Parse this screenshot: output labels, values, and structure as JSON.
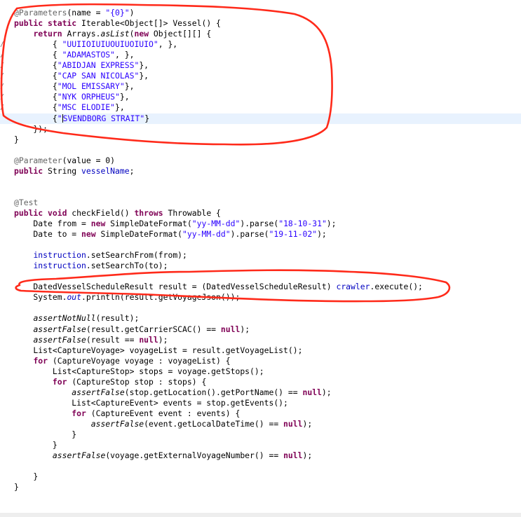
{
  "editor": {
    "lines": [
      [
        [
          "ann",
          "@Parameters"
        ],
        [
          "",
          "(name = "
        ],
        [
          "str",
          "\"{0}\""
        ],
        [
          "",
          ")"
        ]
      ],
      [
        [
          "kw",
          "public static "
        ],
        [
          "",
          "Iterable<Object[]> Vessel() {"
        ]
      ],
      [
        [
          "",
          "    "
        ],
        [
          "kw",
          "return "
        ],
        [
          "",
          "Arrays."
        ],
        [
          "smeth",
          "asList"
        ],
        [
          "",
          "("
        ],
        [
          "kw",
          "new "
        ],
        [
          "",
          "Object[][] {"
        ]
      ],
      [
        [
          "",
          "        { "
        ],
        [
          "str",
          "\"UUIIOIUIUOUIUOIUIO\""
        ],
        [
          "",
          ", },"
        ]
      ],
      [
        [
          "",
          "        { "
        ],
        [
          "str",
          "\"ADAMASTOS\""
        ],
        [
          "",
          ", },"
        ]
      ],
      [
        [
          "",
          "        {"
        ],
        [
          "str",
          "\"ABIDJAN EXPRESS\""
        ],
        [
          "",
          "},"
        ]
      ],
      [
        [
          "",
          "        {"
        ],
        [
          "str",
          "\"CAP SAN NICOLAS\""
        ],
        [
          "",
          "},"
        ]
      ],
      [
        [
          "",
          "        {"
        ],
        [
          "str",
          "\"MOL EMISSARY\""
        ],
        [
          "",
          "},"
        ]
      ],
      [
        [
          "",
          "        {"
        ],
        [
          "str",
          "\"NYK ORPHEUS\""
        ],
        [
          "",
          "},"
        ]
      ],
      [
        [
          "",
          "        {"
        ],
        [
          "str",
          "\"MSC ELODIE\""
        ],
        [
          "",
          "},"
        ]
      ],
      [
        [
          "",
          "        {"
        ],
        [
          "str",
          "\""
        ],
        [
          "caret",
          ""
        ],
        [
          "str",
          "SVENDBORG STRAIT\""
        ],
        [
          "",
          "}"
        ]
      ],
      [
        [
          "",
          "    });"
        ]
      ],
      [
        [
          "",
          "}"
        ]
      ],
      [],
      [
        [
          "ann",
          "@Parameter"
        ],
        [
          "",
          "(value = 0)"
        ]
      ],
      [
        [
          "kw",
          "public "
        ],
        [
          "",
          "String "
        ],
        [
          "fld",
          "vesselName"
        ],
        [
          "",
          ";"
        ]
      ],
      [],
      [],
      [
        [
          "ann",
          "@Test"
        ]
      ],
      [
        [
          "kw",
          "public void "
        ],
        [
          "",
          "checkField() "
        ],
        [
          "kw",
          "throws "
        ],
        [
          "",
          "Throwable {"
        ]
      ],
      [
        [
          "",
          "    Date from = "
        ],
        [
          "kw",
          "new "
        ],
        [
          "",
          "SimpleDateFormat("
        ],
        [
          "str",
          "\"yy-MM-dd\""
        ],
        [
          "",
          ").parse("
        ],
        [
          "str",
          "\"18-10-31\""
        ],
        [
          "",
          ");"
        ]
      ],
      [
        [
          "",
          "    Date to = "
        ],
        [
          "kw",
          "new "
        ],
        [
          "",
          "SimpleDateFormat("
        ],
        [
          "str",
          "\"yy-MM-dd\""
        ],
        [
          "",
          ").parse("
        ],
        [
          "str",
          "\"19-11-02\""
        ],
        [
          "",
          ");"
        ]
      ],
      [],
      [
        [
          "",
          "    "
        ],
        [
          "fld",
          "instruction"
        ],
        [
          "",
          ".setSearchFrom(from);"
        ]
      ],
      [
        [
          "",
          "    "
        ],
        [
          "fld",
          "instruction"
        ],
        [
          "",
          ".setSearchTo(to);"
        ]
      ],
      [],
      [
        [
          "",
          "    DatedVesselScheduleResult result = (DatedVesselScheduleResult) "
        ],
        [
          "fld",
          "crawler"
        ],
        [
          "",
          ".execute();"
        ]
      ],
      [
        [
          "",
          "    System."
        ],
        [
          "sfld",
          "out"
        ],
        [
          "",
          ".println(result.getVoyageJson());"
        ]
      ],
      [],
      [
        [
          "",
          "    "
        ],
        [
          "smeth",
          "assertNotNull"
        ],
        [
          "",
          "(result);"
        ]
      ],
      [
        [
          "",
          "    "
        ],
        [
          "smeth",
          "assertFalse"
        ],
        [
          "",
          "(result.getCarrierSCAC() == "
        ],
        [
          "kw",
          "null"
        ],
        [
          "",
          ");"
        ]
      ],
      [
        [
          "",
          "    "
        ],
        [
          "smeth",
          "assertFalse"
        ],
        [
          "",
          "(result == "
        ],
        [
          "kw",
          "null"
        ],
        [
          "",
          ");"
        ]
      ],
      [
        [
          "",
          "    List<CaptureVoyage> voyageList = result.getVoyageList();"
        ]
      ],
      [
        [
          "",
          "    "
        ],
        [
          "kw",
          "for "
        ],
        [
          "",
          "(CaptureVoyage voyage : voyageList) {"
        ]
      ],
      [
        [
          "",
          "        List<CaptureStop> stops = voyage.getStops();"
        ]
      ],
      [
        [
          "",
          "        "
        ],
        [
          "kw",
          "for "
        ],
        [
          "",
          "(CaptureStop stop : stops) {"
        ]
      ],
      [
        [
          "",
          "            "
        ],
        [
          "smeth",
          "assertFalse"
        ],
        [
          "",
          "(stop.getLocation().getPortName() == "
        ],
        [
          "kw",
          "null"
        ],
        [
          "",
          ");"
        ]
      ],
      [
        [
          "",
          "            List<CaptureEvent> events = stop.getEvents();"
        ]
      ],
      [
        [
          "",
          "            "
        ],
        [
          "kw",
          "for "
        ],
        [
          "",
          "(CaptureEvent event : events) {"
        ]
      ],
      [
        [
          "",
          "                "
        ],
        [
          "smeth",
          "assertFalse"
        ],
        [
          "",
          "(event.getLocalDateTime() == "
        ],
        [
          "kw",
          "null"
        ],
        [
          "",
          ");"
        ]
      ],
      [
        [
          "",
          "            }"
        ]
      ],
      [
        [
          "",
          "        }"
        ]
      ],
      [
        [
          "",
          "        "
        ],
        [
          "smeth",
          "assertFalse"
        ],
        [
          "",
          "(voyage.getExternalVoyageNumber() == "
        ],
        [
          "kw",
          "null"
        ],
        [
          "",
          ");"
        ]
      ],
      [],
      [
        [
          "",
          "    }"
        ]
      ],
      [
        [
          "",
          "}"
        ]
      ]
    ],
    "current_line": 10,
    "gutter_marks": [
      3,
      4,
      5,
      6,
      7,
      8,
      9
    ],
    "gutter_glyph": "/"
  },
  "annotations": {
    "color": "#ff2a1a",
    "marks": [
      "scribble-circle-parameters-block",
      "scribble-oval-execute-line"
    ]
  }
}
